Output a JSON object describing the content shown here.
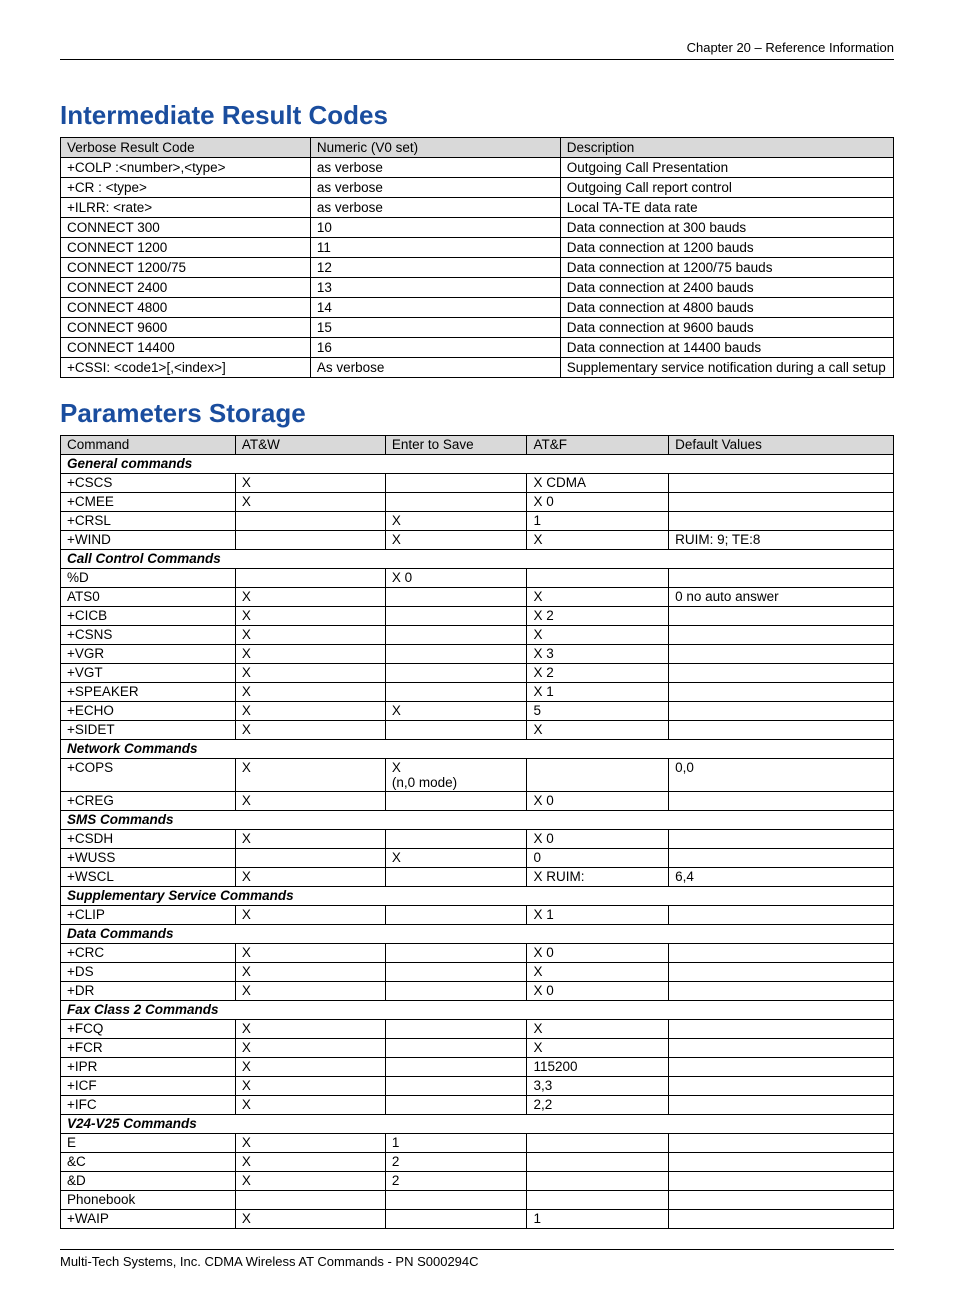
{
  "header": "Chapter 20 – Reference Information",
  "title1": "Intermediate Result Codes",
  "table1": {
    "headers": [
      "Verbose Result Code",
      "Numeric (V0 set)",
      "Description"
    ],
    "rows": [
      [
        "+COLP :<number>,<type>",
        "as verbose",
        "Outgoing Call Presentation"
      ],
      [
        "+CR : <type>",
        "as verbose",
        "Outgoing Call report control"
      ],
      [
        "+ILRR: <rate>",
        "as verbose",
        "Local TA-TE data rate"
      ],
      [
        "CONNECT 300",
        "10",
        "Data connection at 300 bauds"
      ],
      [
        "CONNECT 1200",
        "11",
        "Data connection at 1200 bauds"
      ],
      [
        "CONNECT 1200/75",
        "12",
        "Data connection at 1200/75 bauds"
      ],
      [
        "CONNECT 2400",
        "13",
        "Data connection at 2400 bauds"
      ],
      [
        "CONNECT 4800",
        "14",
        "Data connection at 4800 bauds"
      ],
      [
        "CONNECT 9600",
        "15",
        "Data connection at 9600 bauds"
      ],
      [
        "CONNECT 14400",
        "16",
        "Data connection at 14400 bauds"
      ],
      [
        "+CSSI: <code1>[,<index>]",
        "As verbose",
        "Supplementary service notification during a call setup"
      ]
    ]
  },
  "title2": "Parameters Storage",
  "table2": {
    "headers": [
      "Command",
      "AT&W",
      "Enter to Save",
      "AT&F",
      "Default Values"
    ],
    "rows": [
      {
        "type": "section",
        "label": "General commands"
      },
      {
        "type": "row",
        "cells": [
          "+CSCS",
          "X",
          "",
          "X CDMA",
          ""
        ]
      },
      {
        "type": "row",
        "cells": [
          "+CMEE",
          "X",
          "",
          "X 0",
          ""
        ]
      },
      {
        "type": "row",
        "cells": [
          "+CRSL",
          "",
          "X",
          "1",
          ""
        ]
      },
      {
        "type": "row",
        "cells": [
          "+WIND",
          "",
          "X",
          "X",
          "RUIM: 9; TE:8"
        ]
      },
      {
        "type": "section",
        "label": "Call Control Commands"
      },
      {
        "type": "row",
        "cells": [
          "%D",
          "",
          "X 0",
          "",
          ""
        ]
      },
      {
        "type": "row",
        "cells": [
          "ATS0",
          "X",
          "",
          "X",
          "0 no auto answer"
        ]
      },
      {
        "type": "row",
        "cells": [
          "+CICB",
          "X",
          "",
          "X 2",
          ""
        ]
      },
      {
        "type": "row",
        "cells": [
          "+CSNS",
          "X",
          "",
          "X",
          ""
        ]
      },
      {
        "type": "row",
        "cells": [
          "+VGR",
          "X",
          "",
          "X 3",
          ""
        ]
      },
      {
        "type": "row",
        "cells": [
          "+VGT",
          "X",
          "",
          "X 2",
          ""
        ]
      },
      {
        "type": "row",
        "cells": [
          "+SPEAKER",
          "X",
          "",
          "X 1",
          ""
        ]
      },
      {
        "type": "row",
        "cells": [
          "+ECHO",
          "X",
          "X",
          "5",
          ""
        ]
      },
      {
        "type": "row",
        "cells": [
          "+SIDET",
          "X",
          "",
          "X",
          ""
        ]
      },
      {
        "type": "section",
        "label": "Network Commands"
      },
      {
        "type": "row",
        "cells": [
          "+COPS",
          "X",
          "X\n(n,0 mode)",
          "",
          "0,0"
        ]
      },
      {
        "type": "row",
        "cells": [
          "+CREG",
          "X",
          "",
          "X 0",
          ""
        ]
      },
      {
        "type": "section",
        "label": "SMS Commands"
      },
      {
        "type": "row",
        "cells": [
          "+CSDH",
          "X",
          "",
          "X 0",
          ""
        ]
      },
      {
        "type": "row",
        "cells": [
          "+WUSS",
          "",
          "X",
          "0",
          ""
        ]
      },
      {
        "type": "row",
        "cells": [
          "+WSCL",
          "X",
          "",
          "X RUIM:",
          "6,4"
        ]
      },
      {
        "type": "section",
        "label": "Supplementary Service Commands"
      },
      {
        "type": "row",
        "cells": [
          "+CLIP",
          "X",
          "",
          "X 1",
          ""
        ]
      },
      {
        "type": "section",
        "label": "Data Commands"
      },
      {
        "type": "row",
        "cells": [
          "+CRC",
          "X",
          "",
          "X 0",
          ""
        ]
      },
      {
        "type": "row",
        "cells": [
          "+DS",
          "X",
          "",
          "X",
          ""
        ]
      },
      {
        "type": "row",
        "cells": [
          "+DR",
          "X",
          "",
          "X 0",
          ""
        ]
      },
      {
        "type": "section",
        "label": "Fax Class 2 Commands"
      },
      {
        "type": "row",
        "cells": [
          "+FCQ",
          "X",
          "",
          "X",
          ""
        ]
      },
      {
        "type": "row",
        "cells": [
          "+FCR",
          "X",
          "",
          "X",
          ""
        ]
      },
      {
        "type": "row",
        "cells": [
          "+IPR",
          "X",
          "",
          "115200",
          ""
        ]
      },
      {
        "type": "row",
        "cells": [
          "+ICF",
          "X",
          "",
          "3,3",
          ""
        ]
      },
      {
        "type": "row",
        "cells": [
          "+IFC",
          "X",
          "",
          "2,2",
          ""
        ]
      },
      {
        "type": "section",
        "label": "V24-V25 Commands"
      },
      {
        "type": "row",
        "cells": [
          "E",
          "X",
          "1",
          "",
          ""
        ]
      },
      {
        "type": "row",
        "cells": [
          "&C",
          "X",
          "2",
          "",
          ""
        ]
      },
      {
        "type": "row",
        "cells": [
          "&D",
          "X",
          "2",
          "",
          ""
        ]
      },
      {
        "type": "row",
        "cells": [
          "Phonebook",
          "",
          "",
          "",
          ""
        ]
      },
      {
        "type": "row",
        "cells": [
          "+WAIP",
          "X",
          "",
          "1",
          ""
        ]
      }
    ]
  },
  "footer": "Multi-Tech Systems, Inc. CDMA Wireless AT Commands - PN S000294C"
}
